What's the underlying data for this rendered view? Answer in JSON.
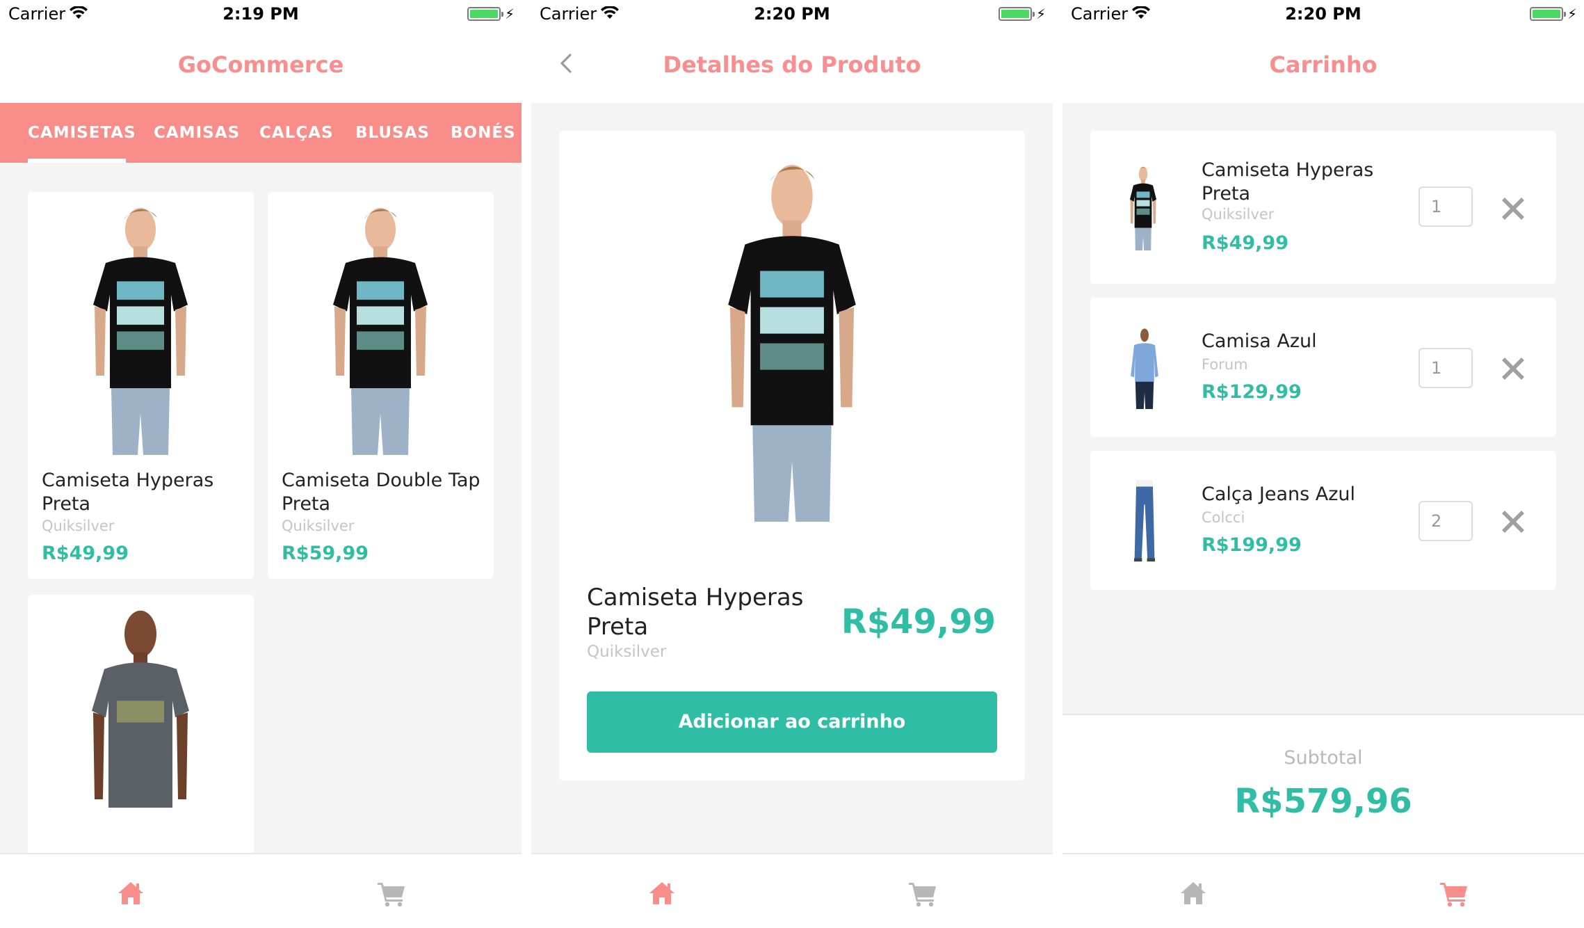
{
  "status_bars": [
    {
      "carrier": "Carrier",
      "time": "2:19 PM"
    },
    {
      "carrier": "Carrier",
      "time": "2:20 PM"
    },
    {
      "carrier": "Carrier",
      "time": "2:20 PM"
    }
  ],
  "colors": {
    "brand": "#f98d8a",
    "accent": "#2fbda5",
    "background": "#f4f4f4"
  },
  "home": {
    "title": "GoCommerce",
    "categories": [
      "CAMISETAS",
      "CAMISAS",
      "CALÇAS",
      "BLUSAS",
      "BONÉS"
    ],
    "active_category": "CAMISETAS",
    "products": [
      {
        "name": "Camiseta Hyperas Preta",
        "brand": "Quiksilver",
        "price": "R$49,99",
        "image": "black-tshirt-model"
      },
      {
        "name": "Camiseta Double Tap Preta",
        "brand": "Quiksilver",
        "price": "R$59,99",
        "image": "black-tshirt-model"
      },
      {
        "name": "",
        "brand": "",
        "price": "",
        "image": "grey-tshirt-model"
      }
    ]
  },
  "detail": {
    "title": "Detalhes do Produto",
    "product": {
      "name": "Camiseta Hyperas Preta",
      "brand": "Quiksilver",
      "price": "R$49,99",
      "image": "black-tshirt-model"
    },
    "add_button": "Adicionar ao carrinho"
  },
  "cart": {
    "title": "Carrinho",
    "items": [
      {
        "name": "Camiseta Hyperas Preta",
        "brand": "Quiksilver",
        "price": "R$49,99",
        "quantity": "1",
        "image": "black-tshirt-model"
      },
      {
        "name": "Camisa Azul",
        "brand": "Forum",
        "price": "R$129,99",
        "quantity": "1",
        "image": "blue-shirt-model"
      },
      {
        "name": "Calça Jeans Azul",
        "brand": "Colcci",
        "price": "R$199,99",
        "quantity": "2",
        "image": "blue-jeans-model"
      }
    ],
    "subtotal_label": "Subtotal",
    "subtotal_value": "R$579,96"
  },
  "tabbar": {
    "items": [
      "home-icon",
      "cart-icon"
    ]
  }
}
